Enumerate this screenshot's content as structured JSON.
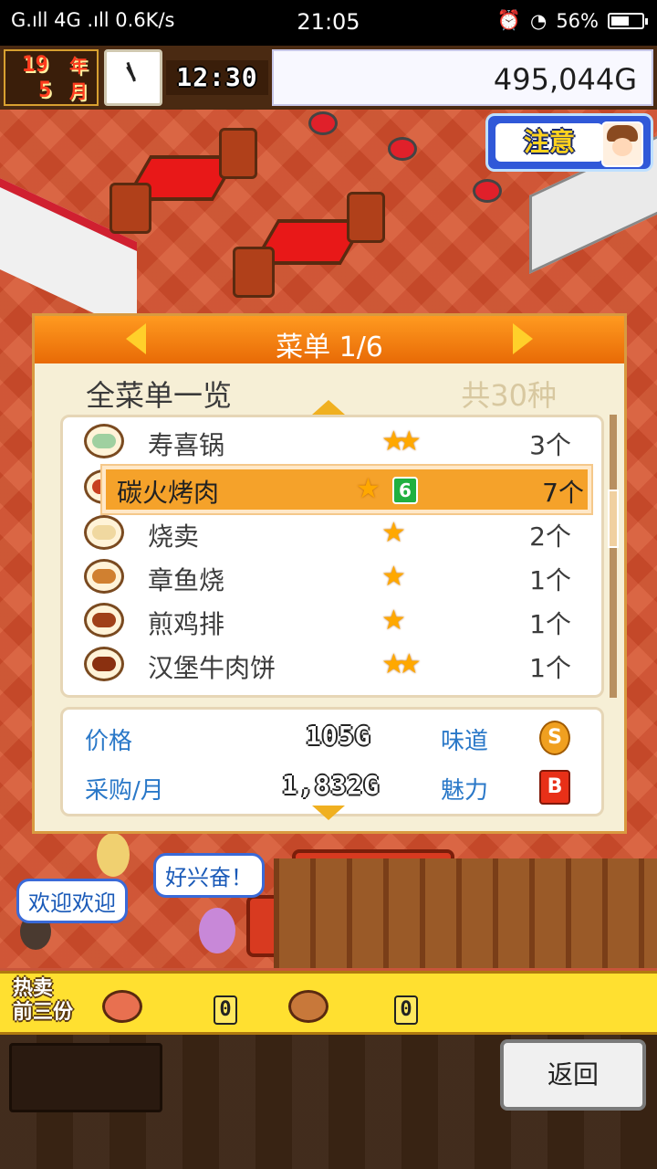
{
  "status_bar": {
    "left": "G.ıll 4G .ıll 0.6K/s",
    "time": "21:05",
    "battery": "56%"
  },
  "top_bar": {
    "year": "19",
    "year_unit": "年",
    "month": "5",
    "month_unit": "月",
    "game_time": "12:30",
    "money": "495,044G"
  },
  "notice_button": {
    "label": "注意"
  },
  "menu_panel": {
    "title": "菜单 1/6",
    "list_title": "全菜单一览",
    "total": "共30种",
    "items": [
      {
        "name": "寿喜锅",
        "stars": "★★",
        "level": "",
        "qty": "3个",
        "icon": "hotpot-icon",
        "color": "#9fd0a0"
      },
      {
        "name": "碳火烤肉",
        "stars": "★",
        "level": "6",
        "qty": "7个",
        "icon": "grilled-meat-icon",
        "color": "#c84020"
      },
      {
        "name": "烧卖",
        "stars": "★",
        "level": "",
        "qty": "2个",
        "icon": "shumai-icon",
        "color": "#f0d8a0"
      },
      {
        "name": "章鱼烧",
        "stars": "★",
        "level": "",
        "qty": "1个",
        "icon": "takoyaki-icon",
        "color": "#d08030"
      },
      {
        "name": "煎鸡排",
        "stars": "★",
        "level": "",
        "qty": "1个",
        "icon": "chicken-cutlet-icon",
        "color": "#a04018"
      },
      {
        "name": "汉堡牛肉饼",
        "stars": "★★",
        "level": "",
        "qty": "1个",
        "icon": "hamburg-steak-icon",
        "color": "#8a3010"
      }
    ],
    "selected_index": 1,
    "info": {
      "price_label": "价格",
      "price_value": "105G",
      "taste_label": "味道",
      "taste_grade": "S",
      "purchase_label": "采购/月",
      "purchase_value": "1,832G",
      "charm_label": "魅力",
      "charm_grade": "B"
    }
  },
  "bubbles": {
    "welcome": "欢迎欢迎",
    "excited": "好兴奋！"
  },
  "hot_bar": {
    "label_line1": "热卖",
    "label_line2": "前三份",
    "items": [
      {
        "icon": "dish-icon",
        "count": "0"
      },
      {
        "icon": "dish-icon",
        "count": "0"
      }
    ]
  },
  "back_button": {
    "label": "返回"
  },
  "colors": {
    "accent_orange": "#f5a22a",
    "info_blue": "#2a78c8",
    "hot_bar_yellow": "#ffe030"
  }
}
